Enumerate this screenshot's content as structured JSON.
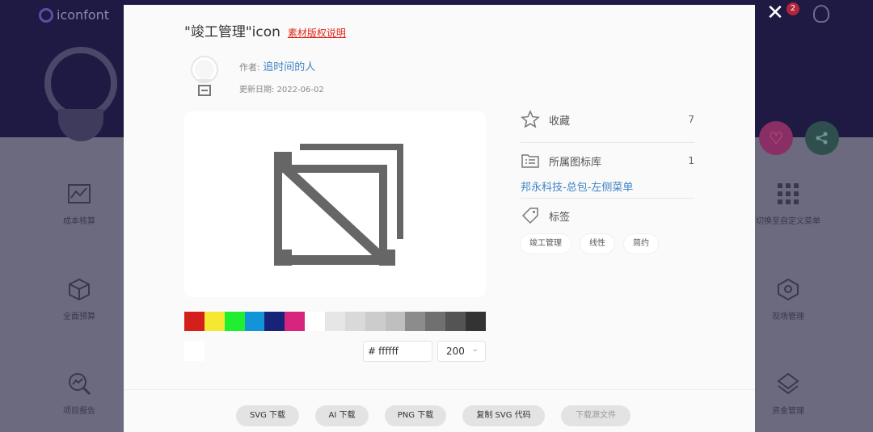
{
  "background": {
    "logo_text": "iconfont",
    "notification_count": "2",
    "close_glyph": "✕",
    "left_menu": [
      "成本核算",
      "全面预算",
      "项目报告"
    ],
    "right_menu": [
      "切换至自定义菜单",
      "现场管理",
      "资金管理"
    ]
  },
  "modal": {
    "title": "\"竣工管理\"icon",
    "copyright_link": "素材版权说明",
    "author_label": "作者:",
    "author_name": "追时间的人",
    "date_label": "更新日期:",
    "date_value": "2022-06-02",
    "preview_icon": "completion-management-icon",
    "swatches": [
      "#d4201b",
      "#f6e733",
      "#20ee30",
      "#1394d9",
      "#172378",
      "#d7247d",
      "#ffffff",
      "#e6e6e6",
      "#d9d9d9",
      "#cccccc",
      "#bfbfbf",
      "#8c8c8c",
      "#707070",
      "#545454",
      "#333333"
    ],
    "color_prefix": "#",
    "color_value": "ffffff",
    "size_value": "200",
    "info": {
      "favorite_label": "收藏",
      "favorite_count": "7",
      "library_label": "所属图标库",
      "library_count": "1",
      "library_name": "邦永科技-总包-左侧菜单",
      "tags_label": "标签",
      "tags": [
        "竣工管理",
        "线性",
        "简约"
      ]
    },
    "buttons": {
      "svg": "SVG 下载",
      "ai": "AI 下载",
      "png": "PNG 下载",
      "copy_svg": "复制 SVG 代码",
      "source": "下载源文件"
    }
  }
}
